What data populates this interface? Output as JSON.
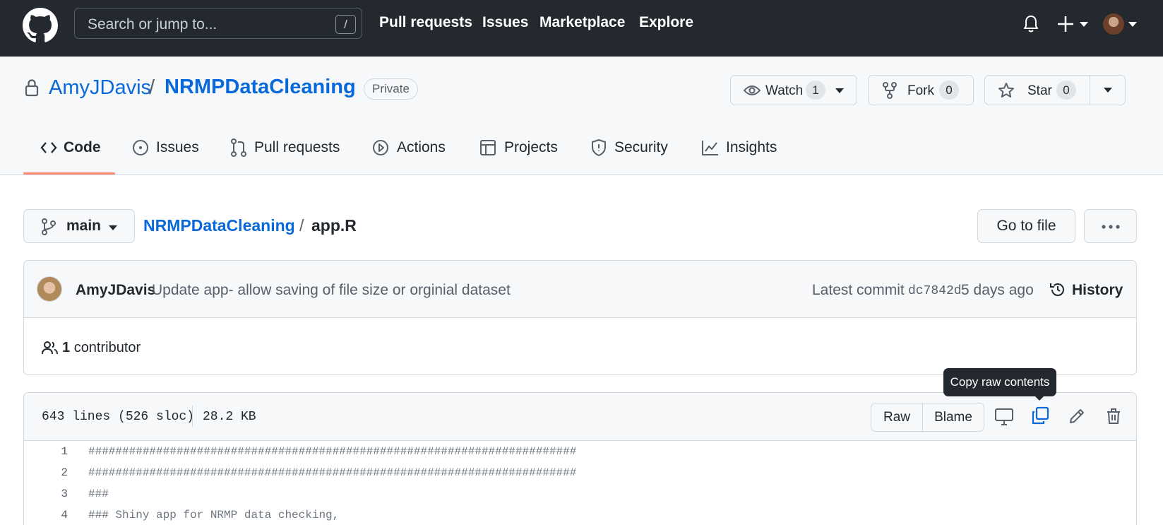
{
  "header": {
    "search_placeholder": "Search or jump to...",
    "search_shortcut": "/",
    "nav": [
      "Pull requests",
      "Issues",
      "Marketplace",
      "Explore"
    ]
  },
  "repo": {
    "owner": "AmyJDavis",
    "separator": "/",
    "name": "NRMPDataCleaning",
    "visibility": "Private",
    "watch_label": "Watch",
    "watch_count": "1",
    "fork_label": "Fork",
    "fork_count": "0",
    "star_label": "Star",
    "star_count": "0"
  },
  "tabs": [
    {
      "label": "Code",
      "icon": "code-icon",
      "selected": true
    },
    {
      "label": "Issues",
      "icon": "issue-icon"
    },
    {
      "label": "Pull requests",
      "icon": "pull-request-icon"
    },
    {
      "label": "Actions",
      "icon": "play-icon"
    },
    {
      "label": "Projects",
      "icon": "table-icon"
    },
    {
      "label": "Security",
      "icon": "shield-icon"
    },
    {
      "label": "Insights",
      "icon": "graph-icon"
    }
  ],
  "breadcrumb": {
    "branch": "main",
    "repo": "NRMPDataCleaning",
    "separator": "/",
    "file": "app.R",
    "go_to_file": "Go to file"
  },
  "commit": {
    "author": "AmyJDavis",
    "message": "Update app- allow saving of file size or orginial dataset",
    "latest_label": "Latest commit",
    "sha": "dc7842d",
    "age": "5 days ago",
    "history": "History",
    "contributors_count": "1",
    "contributors_label": "contributor"
  },
  "file": {
    "lines_info": "643 lines (526 sloc)",
    "size": "28.2 KB",
    "raw": "Raw",
    "blame": "Blame",
    "tooltip": "Copy raw contents",
    "lines": [
      {
        "n": "1",
        "text": "########################################################################"
      },
      {
        "n": "2",
        "text": "########################################################################"
      },
      {
        "n": "3",
        "text": "###"
      },
      {
        "n": "4",
        "text": "### Shiny app for NRMP data checking,"
      }
    ]
  },
  "colors": {
    "header_bg": "#24292f",
    "link": "#0969da",
    "tab_underline": "#fd8c73",
    "copy_icon_active": "#0969da"
  }
}
